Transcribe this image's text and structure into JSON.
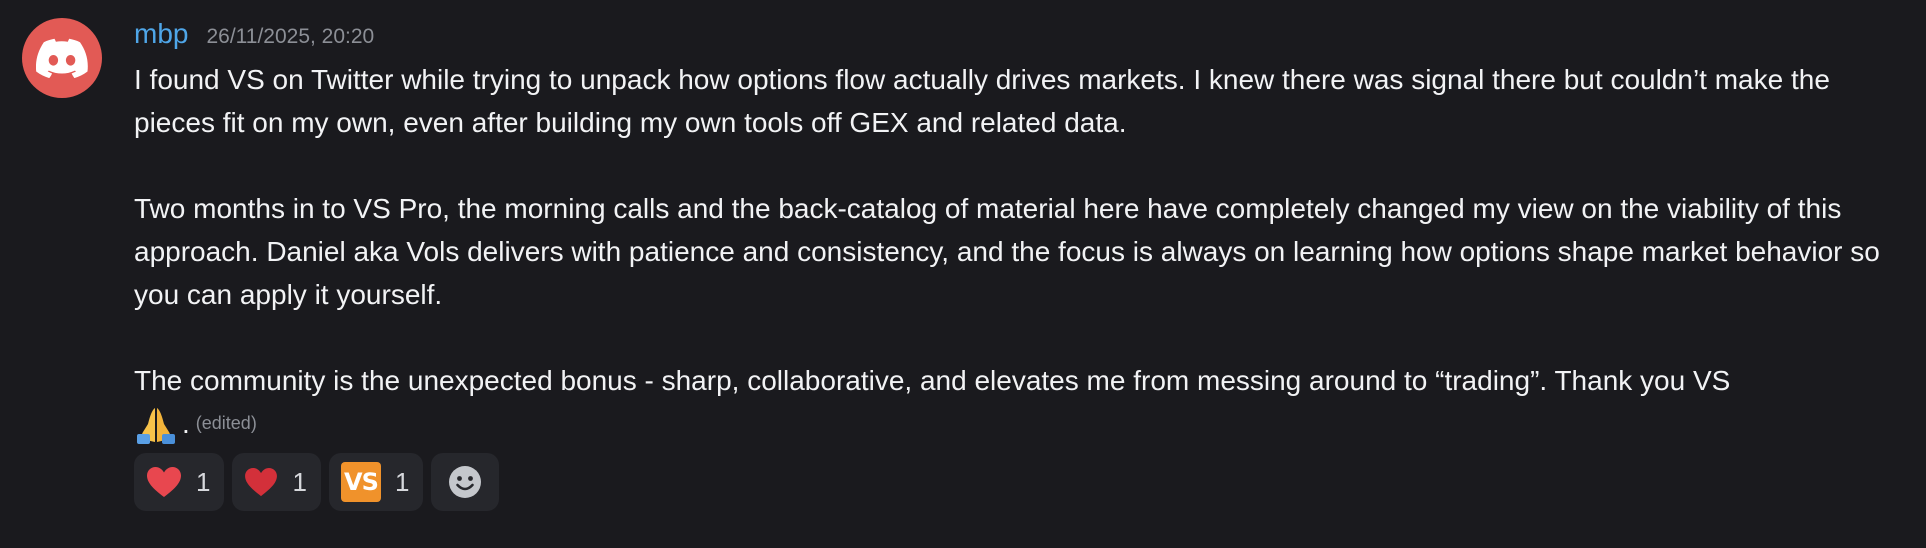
{
  "message": {
    "username": "mbp",
    "timestamp": "26/11/2025, 20:20",
    "paragraphs": [
      "I found VS on Twitter while trying to unpack how options flow actually drives markets. I knew there was signal there but couldn’t make the pieces fit on my own, even after building my own tools off GEX and related data.",
      "Two months in to VS Pro, the morning calls and the back-catalog of material here have completely changed my view on the viability of this approach. Daniel aka Vols delivers with patience and consistency, and the focus is always on learning how options shape market behavior so you can apply it yourself.",
      "The community is the unexpected bonus - sharp, collaborative, and elevates me from messing around to “trading”. Thank you VS"
    ],
    "trailing_punctuation": ".",
    "edited_label": "(edited)",
    "emoji_icon": "folded-hands-icon"
  },
  "reactions": [
    {
      "icon": "red-heart-icon",
      "count": "1"
    },
    {
      "icon": "heart-icon",
      "count": "1"
    },
    {
      "icon": "vs-logo-icon",
      "label": "VS",
      "count": "1"
    }
  ],
  "colors": {
    "background": "#1a1a1e",
    "username": "#4fa6e8",
    "avatar": "#e25a55",
    "text": "#f2f3f5",
    "muted": "#8c8f96",
    "reaction_bg": "#26272c",
    "vs_badge": "#f0922b"
  }
}
